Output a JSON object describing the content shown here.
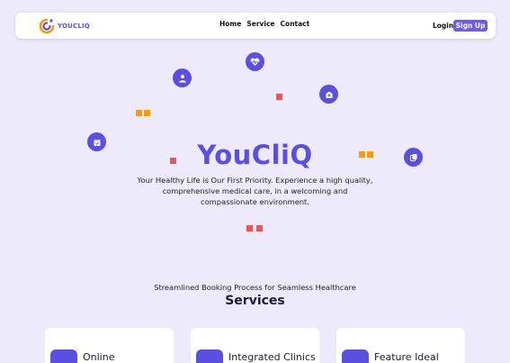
{
  "nav": {
    "logo_text": "YOUCLIQ",
    "links": [
      "Home",
      "Service",
      "Contact"
    ],
    "login": "Login",
    "signup": "Sign Up"
  },
  "hero": {
    "title": "YouCliQ",
    "subtitle": "Your Healthy Life is Our First Priority. Experience a high quality, comprehensive medical care, in a welcoming and compassionate environment."
  },
  "services": {
    "tagline": "Streamlined Booking Process for Seamless Healthcare",
    "heading": "Services",
    "cards": [
      "Online",
      "Integrated Clinics",
      "Feature Ideal"
    ]
  },
  "colors": {
    "accent": "#5b4fe0",
    "orange": "#f39c12",
    "red": "#f05454",
    "bg": "#eceafb"
  },
  "icons": [
    "user-doctor-icon",
    "heart-pulse-icon",
    "hospital-icon",
    "calendar-icon",
    "documents-icon"
  ]
}
